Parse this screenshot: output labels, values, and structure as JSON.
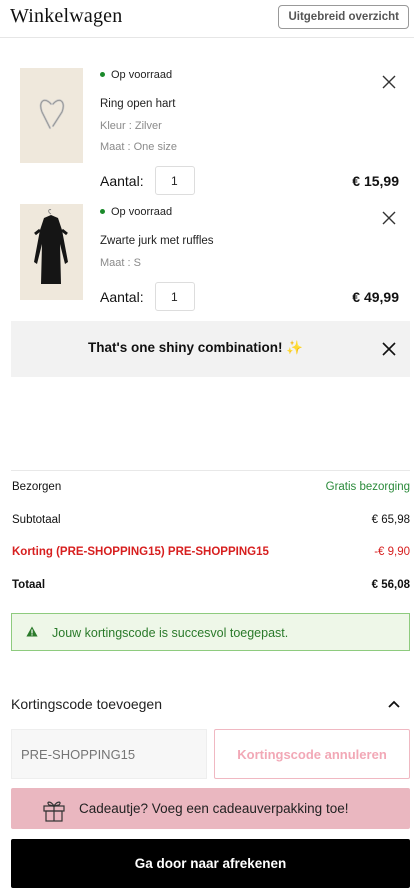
{
  "header": {
    "title": "Winkelwagen",
    "overview_button": "Uitgebreid overzicht"
  },
  "items": [
    {
      "stock": "Op voorraad",
      "name": "Ring open hart",
      "meta": [
        "Kleur : Zilver",
        "Maat : One size"
      ],
      "qty_label": "Aantal:",
      "qty": "1",
      "price": "€ 15,99",
      "image": "ring-open-heart-photo"
    },
    {
      "stock": "Op voorraad",
      "name": "Zwarte jurk met ruffles",
      "meta": [
        "Maat : S"
      ],
      "qty_label": "Aantal:",
      "qty": "1",
      "price": "€ 49,99",
      "image": "black-ruffle-dress-photo"
    }
  ],
  "promo": {
    "text": "That's one shiny combination! ✨"
  },
  "summary": {
    "delivery_label": "Bezorgen",
    "delivery_value": "Gratis bezorging",
    "subtotal_label": "Subtotaal",
    "subtotal_value": "€ 65,98",
    "discount_label": "Korting (PRE-SHOPPING15) PRE-SHOPPING15",
    "discount_value": "-€ 9,90",
    "total_label": "Totaal",
    "total_value": "€ 56,08"
  },
  "success": {
    "message": "Jouw kortingscode is succesvol toegepast."
  },
  "coupon": {
    "heading": "Kortingscode toevoegen",
    "placeholder": "PRE-SHOPPING15",
    "cancel_button": "Kortingscode annuleren"
  },
  "gift": {
    "text": "Cadeautje? Voeg een cadeauverpakking toe!"
  },
  "checkout": {
    "button": "Ga door naar afrekenen"
  },
  "colors": {
    "in_stock": "#1a8a2a",
    "discount": "#d71f1f",
    "success_bg": "#eef7e8",
    "gift_bg": "#eab7c0",
    "checkout_bg": "#000000"
  }
}
